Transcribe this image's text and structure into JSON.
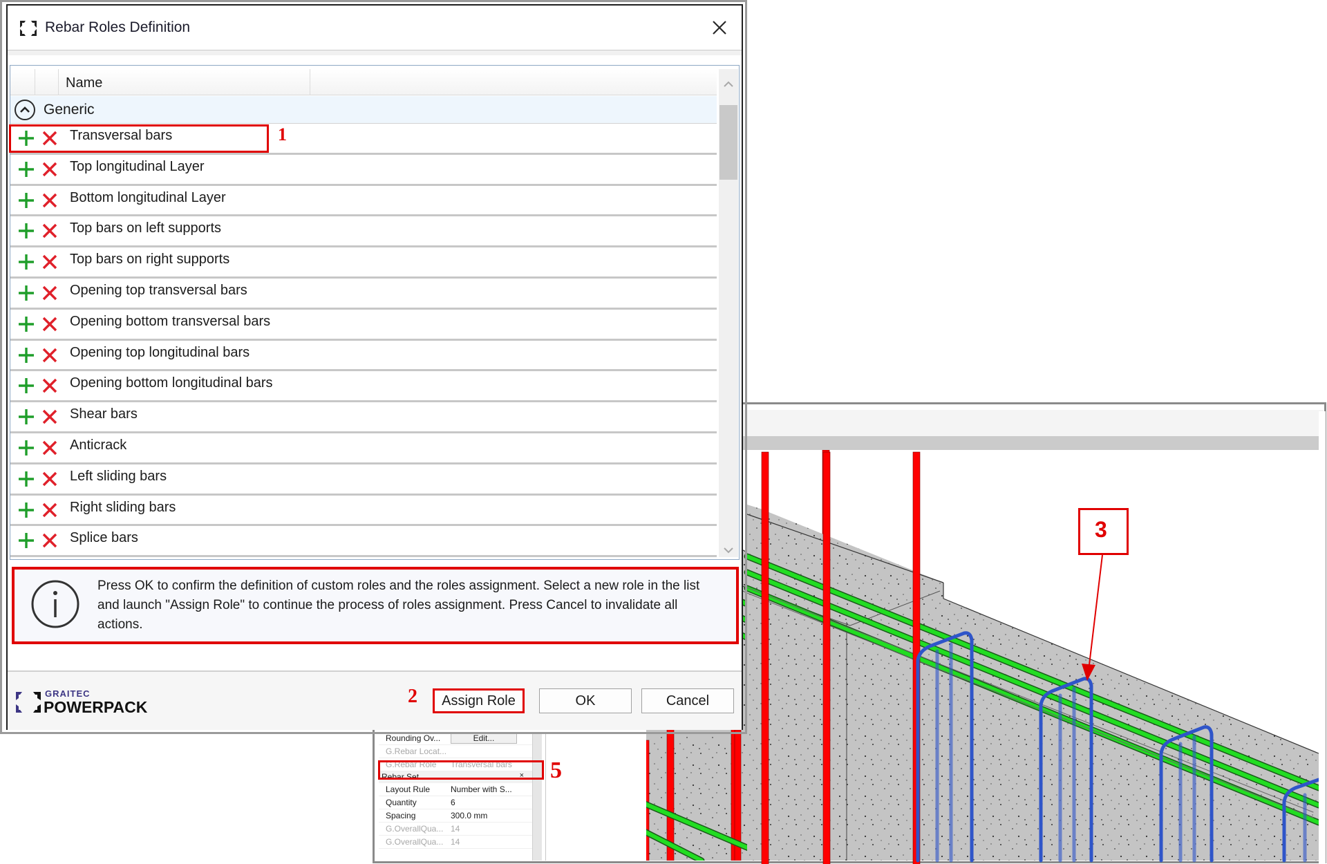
{
  "dialog": {
    "title": "Rebar Roles Definition",
    "close_label": "×",
    "list": {
      "column_header": "Name",
      "group": {
        "label": "Generic",
        "expanded": true
      },
      "roles": [
        "Transversal bars",
        "Top longitudinal Layer",
        "Bottom longitudinal Layer",
        "Top bars on left supports",
        "Top bars on right supports",
        "Opening top transversal bars",
        "Opening bottom transversal bars",
        "Opening top longitudinal bars",
        "Opening bottom longitudinal bars",
        "Shear bars",
        "Anticrack",
        "Left sliding bars",
        "Right sliding bars",
        "Splice bars"
      ]
    },
    "info_message": "Press OK to confirm the definition of custom roles and the roles assignment. Select a new role in the list and launch \"Assign Role\" to continue the process of roles assignment. Press Cancel to invalidate all actions.",
    "logo": {
      "line1": "GRAITEC",
      "line2": "POWERPACK"
    },
    "buttons": {
      "assign_role": "Assign Role",
      "ok": "OK",
      "cancel": "Cancel"
    }
  },
  "properties": {
    "rows_top": [
      {
        "key": "Rounding Ov...",
        "value": "Edit...",
        "is_button": true,
        "dim": false
      },
      {
        "key": "G.Rebar Locat...",
        "value": "",
        "dim": true
      },
      {
        "key": "G.Rebar Role",
        "value": "Transversal bars",
        "dim": true
      }
    ],
    "section": {
      "title": "Rebar Set",
      "collapse_glyph": "×"
    },
    "rows_bottom": [
      {
        "key": "Layout Rule",
        "value": "Number with S...",
        "dim": false
      },
      {
        "key": "Quantity",
        "value": "6",
        "dim": false
      },
      {
        "key": "Spacing",
        "value": "300.0 mm",
        "dim": false
      },
      {
        "key": "G.OverallQua...",
        "value": "14",
        "dim": true
      },
      {
        "key": "G.OverallQua...",
        "value": "14",
        "dim": true
      }
    ]
  },
  "annotations": {
    "marker_1": "1",
    "marker_2": "2",
    "marker_3": "3",
    "marker_5": "5"
  },
  "colors": {
    "annotation_red": "#e00000",
    "add_green": "#1f9e2a",
    "delete_red": "#e0202a",
    "rebar_red": "#ff0000",
    "rebar_green": "#22dd22",
    "rebar_blue": "#2f55c9",
    "rebar_yellow": "#f4e21a",
    "concrete": "#c4c4c4"
  }
}
